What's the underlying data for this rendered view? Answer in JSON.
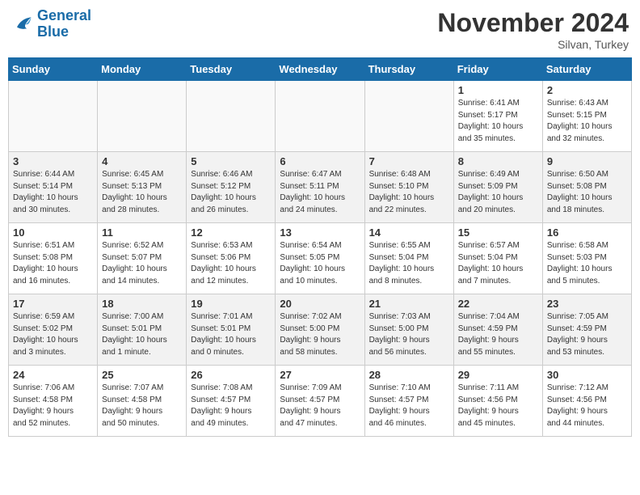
{
  "logo": {
    "line1": "General",
    "line2": "Blue"
  },
  "title": "November 2024",
  "location": "Silvan, Turkey",
  "days_of_week": [
    "Sunday",
    "Monday",
    "Tuesday",
    "Wednesday",
    "Thursday",
    "Friday",
    "Saturday"
  ],
  "weeks": [
    {
      "cells": [
        {
          "empty": true
        },
        {
          "empty": true
        },
        {
          "empty": true
        },
        {
          "empty": true
        },
        {
          "empty": true
        },
        {
          "day": 1,
          "info": "Sunrise: 6:41 AM\nSunset: 5:17 PM\nDaylight: 10 hours\nand 35 minutes."
        },
        {
          "day": 2,
          "info": "Sunrise: 6:43 AM\nSunset: 5:15 PM\nDaylight: 10 hours\nand 32 minutes."
        }
      ]
    },
    {
      "cells": [
        {
          "day": 3,
          "info": "Sunrise: 6:44 AM\nSunset: 5:14 PM\nDaylight: 10 hours\nand 30 minutes."
        },
        {
          "day": 4,
          "info": "Sunrise: 6:45 AM\nSunset: 5:13 PM\nDaylight: 10 hours\nand 28 minutes."
        },
        {
          "day": 5,
          "info": "Sunrise: 6:46 AM\nSunset: 5:12 PM\nDaylight: 10 hours\nand 26 minutes."
        },
        {
          "day": 6,
          "info": "Sunrise: 6:47 AM\nSunset: 5:11 PM\nDaylight: 10 hours\nand 24 minutes."
        },
        {
          "day": 7,
          "info": "Sunrise: 6:48 AM\nSunset: 5:10 PM\nDaylight: 10 hours\nand 22 minutes."
        },
        {
          "day": 8,
          "info": "Sunrise: 6:49 AM\nSunset: 5:09 PM\nDaylight: 10 hours\nand 20 minutes."
        },
        {
          "day": 9,
          "info": "Sunrise: 6:50 AM\nSunset: 5:08 PM\nDaylight: 10 hours\nand 18 minutes."
        }
      ]
    },
    {
      "cells": [
        {
          "day": 10,
          "info": "Sunrise: 6:51 AM\nSunset: 5:08 PM\nDaylight: 10 hours\nand 16 minutes."
        },
        {
          "day": 11,
          "info": "Sunrise: 6:52 AM\nSunset: 5:07 PM\nDaylight: 10 hours\nand 14 minutes."
        },
        {
          "day": 12,
          "info": "Sunrise: 6:53 AM\nSunset: 5:06 PM\nDaylight: 10 hours\nand 12 minutes."
        },
        {
          "day": 13,
          "info": "Sunrise: 6:54 AM\nSunset: 5:05 PM\nDaylight: 10 hours\nand 10 minutes."
        },
        {
          "day": 14,
          "info": "Sunrise: 6:55 AM\nSunset: 5:04 PM\nDaylight: 10 hours\nand 8 minutes."
        },
        {
          "day": 15,
          "info": "Sunrise: 6:57 AM\nSunset: 5:04 PM\nDaylight: 10 hours\nand 7 minutes."
        },
        {
          "day": 16,
          "info": "Sunrise: 6:58 AM\nSunset: 5:03 PM\nDaylight: 10 hours\nand 5 minutes."
        }
      ]
    },
    {
      "cells": [
        {
          "day": 17,
          "info": "Sunrise: 6:59 AM\nSunset: 5:02 PM\nDaylight: 10 hours\nand 3 minutes."
        },
        {
          "day": 18,
          "info": "Sunrise: 7:00 AM\nSunset: 5:01 PM\nDaylight: 10 hours\nand 1 minute."
        },
        {
          "day": 19,
          "info": "Sunrise: 7:01 AM\nSunset: 5:01 PM\nDaylight: 10 hours\nand 0 minutes."
        },
        {
          "day": 20,
          "info": "Sunrise: 7:02 AM\nSunset: 5:00 PM\nDaylight: 9 hours\nand 58 minutes."
        },
        {
          "day": 21,
          "info": "Sunrise: 7:03 AM\nSunset: 5:00 PM\nDaylight: 9 hours\nand 56 minutes."
        },
        {
          "day": 22,
          "info": "Sunrise: 7:04 AM\nSunset: 4:59 PM\nDaylight: 9 hours\nand 55 minutes."
        },
        {
          "day": 23,
          "info": "Sunrise: 7:05 AM\nSunset: 4:59 PM\nDaylight: 9 hours\nand 53 minutes."
        }
      ]
    },
    {
      "cells": [
        {
          "day": 24,
          "info": "Sunrise: 7:06 AM\nSunset: 4:58 PM\nDaylight: 9 hours\nand 52 minutes."
        },
        {
          "day": 25,
          "info": "Sunrise: 7:07 AM\nSunset: 4:58 PM\nDaylight: 9 hours\nand 50 minutes."
        },
        {
          "day": 26,
          "info": "Sunrise: 7:08 AM\nSunset: 4:57 PM\nDaylight: 9 hours\nand 49 minutes."
        },
        {
          "day": 27,
          "info": "Sunrise: 7:09 AM\nSunset: 4:57 PM\nDaylight: 9 hours\nand 47 minutes."
        },
        {
          "day": 28,
          "info": "Sunrise: 7:10 AM\nSunset: 4:57 PM\nDaylight: 9 hours\nand 46 minutes."
        },
        {
          "day": 29,
          "info": "Sunrise: 7:11 AM\nSunset: 4:56 PM\nDaylight: 9 hours\nand 45 minutes."
        },
        {
          "day": 30,
          "info": "Sunrise: 7:12 AM\nSunset: 4:56 PM\nDaylight: 9 hours\nand 44 minutes."
        }
      ]
    }
  ]
}
